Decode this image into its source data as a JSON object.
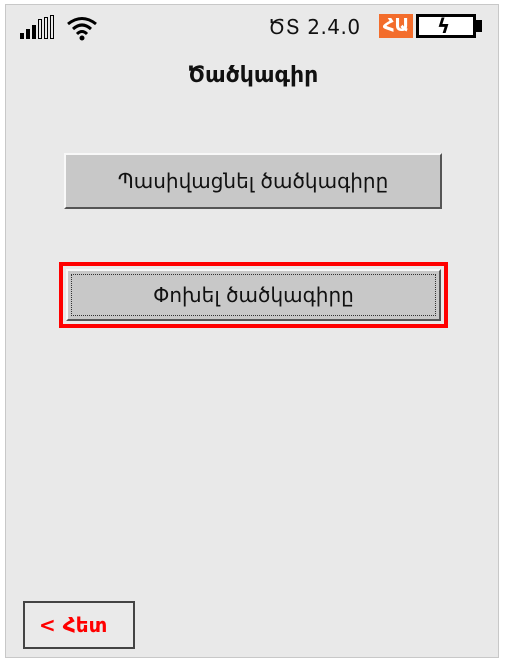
{
  "status_bar": {
    "signal_icon": "signal-strength-icon",
    "wifi_icon": "wifi-icon",
    "version": "ԾՏ 2.4.0",
    "language_badge": "ՀԱ",
    "battery_icon": "battery-charging-icon",
    "accent_color": "#f36d2c"
  },
  "screen": {
    "title": "Ծածկագիր"
  },
  "buttons": {
    "deactivate_label": "Պասիվացնել ծածկագիրը",
    "change_label": "Փոխել ծածկագիրը",
    "focus_color": "#ff0000"
  },
  "nav": {
    "back_label": "< Հետ"
  }
}
